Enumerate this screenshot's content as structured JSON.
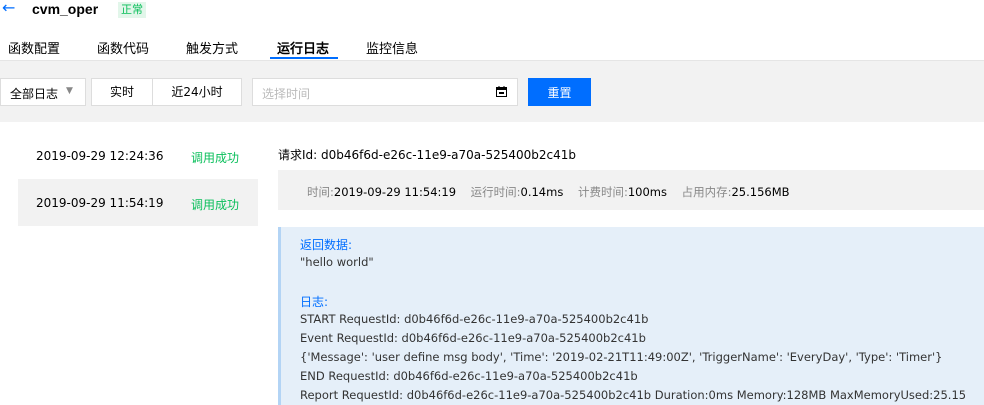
{
  "header": {
    "back_icon": "arrow-left-icon",
    "function_name": "cvm_oper",
    "status": "正常"
  },
  "tabs": [
    "函数配置",
    "函数代码",
    "触发方式",
    "运行日志",
    "监控信息"
  ],
  "toolbar": {
    "log_filter": "全部日志",
    "realtime": "实时",
    "last24h": "近24小时",
    "date_placeholder": "选择时间",
    "reset": "重置"
  },
  "log_list": [
    {
      "time": "2019-09-29 12:24:36",
      "status": "调用成功"
    },
    {
      "time": "2019-09-29 11:54:19",
      "status": "调用成功"
    }
  ],
  "detail": {
    "request_label": "请求Id:",
    "request_id": "d0b46f6d-e26c-11e9-a70a-525400b2c41b",
    "time_label": "时间:",
    "time": "2019-09-29 11:54:19",
    "runtime_label": "运行时间:",
    "runtime": "0.14ms",
    "billed_label": "计费时间:",
    "billed": "100ms",
    "memory_label": "占用内存:",
    "memory": "25.156MB",
    "return_label": "返回数据:",
    "return_value": "\"hello world\"",
    "log_label": "日志:",
    "log_lines": [
      "START RequestId: d0b46f6d-e26c-11e9-a70a-525400b2c41b",
      "Event RequestId: d0b46f6d-e26c-11e9-a70a-525400b2c41b",
      "{'Message': 'user define msg body', 'Time': '2019-02-21T11:49:00Z', 'TriggerName': 'EveryDay', 'Type': 'Timer'}",
      "END RequestId: d0b46f6d-e26c-11e9-a70a-525400b2c41b",
      "Report RequestId: d0b46f6d-e26c-11e9-a70a-525400b2c41b Duration:0ms Memory:128MB MaxMemoryUsed:25.15"
    ]
  },
  "colors": {
    "accent": "#006eff",
    "success": "#0abf5b",
    "panel_bg": "#f2f2f2",
    "log_bg": "#e5eff9"
  }
}
